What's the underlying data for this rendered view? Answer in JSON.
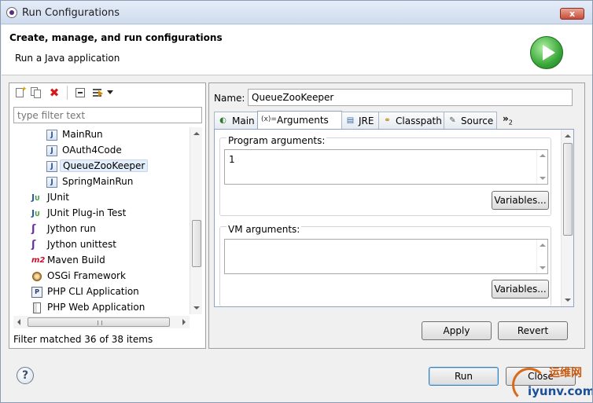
{
  "window": {
    "title": "Run Configurations",
    "close_label": "x"
  },
  "header": {
    "title": "Create, manage, and run configurations",
    "subtitle": "Run a Java application"
  },
  "left_panel": {
    "toolbar": [
      "new-configuration-icon",
      "duplicate-icon",
      "delete-icon",
      "collapse-all-icon",
      "filter-icon",
      "view-menu-icon"
    ],
    "filter_placeholder": "type filter text",
    "tree_items": [
      {
        "label": "MainRun",
        "icon": "java-app-icon",
        "selected": false
      },
      {
        "label": "OAuth4Code",
        "icon": "java-app-icon",
        "selected": false
      },
      {
        "label": "QueueZooKeeper",
        "icon": "java-app-icon",
        "selected": true
      },
      {
        "label": "SpringMainRun",
        "icon": "java-app-icon",
        "selected": false
      },
      {
        "label": "JUnit",
        "icon": "junit-icon",
        "selected": false
      },
      {
        "label": "JUnit Plug-in Test",
        "icon": "junit-plugin-icon",
        "selected": false
      },
      {
        "label": "Jython run",
        "icon": "jython-icon",
        "selected": false
      },
      {
        "label": "Jython unittest",
        "icon": "jython-unittest-icon",
        "selected": false
      },
      {
        "label": "Maven Build",
        "icon": "maven-icon",
        "selected": false
      },
      {
        "label": "OSGi Framework",
        "icon": "osgi-icon",
        "selected": false
      },
      {
        "label": "PHP CLI Application",
        "icon": "php-cli-icon",
        "selected": false
      },
      {
        "label": "PHP Web Application",
        "icon": "php-web-icon",
        "selected": false
      }
    ],
    "status": "Filter matched 36 of 38 items"
  },
  "right_panel": {
    "name_label": "Name:",
    "name_value": "QueueZooKeeper",
    "tabs": [
      {
        "label": "Main",
        "icon": "main-tab-icon"
      },
      {
        "label": "Arguments",
        "icon": "arguments-tab-icon",
        "active": true
      },
      {
        "label": "JRE",
        "icon": "jre-tab-icon"
      },
      {
        "label": "Classpath",
        "icon": "classpath-tab-icon"
      },
      {
        "label": "Source",
        "icon": "source-tab-icon"
      }
    ],
    "more_tabs": "»",
    "more_tabs_count": "2",
    "program_args": {
      "label": "Program arguments:",
      "value": "1",
      "variables_label": "Variables..."
    },
    "vm_args": {
      "label": "VM arguments:",
      "value": "",
      "variables_label": "Variables..."
    },
    "apply_label": "Apply",
    "revert_label": "Revert"
  },
  "footer": {
    "help_label": "?",
    "run_label": "Run",
    "close_label": "Close"
  },
  "watermark": {
    "text_cn": "运维网",
    "text_en": "iyunv.com"
  }
}
